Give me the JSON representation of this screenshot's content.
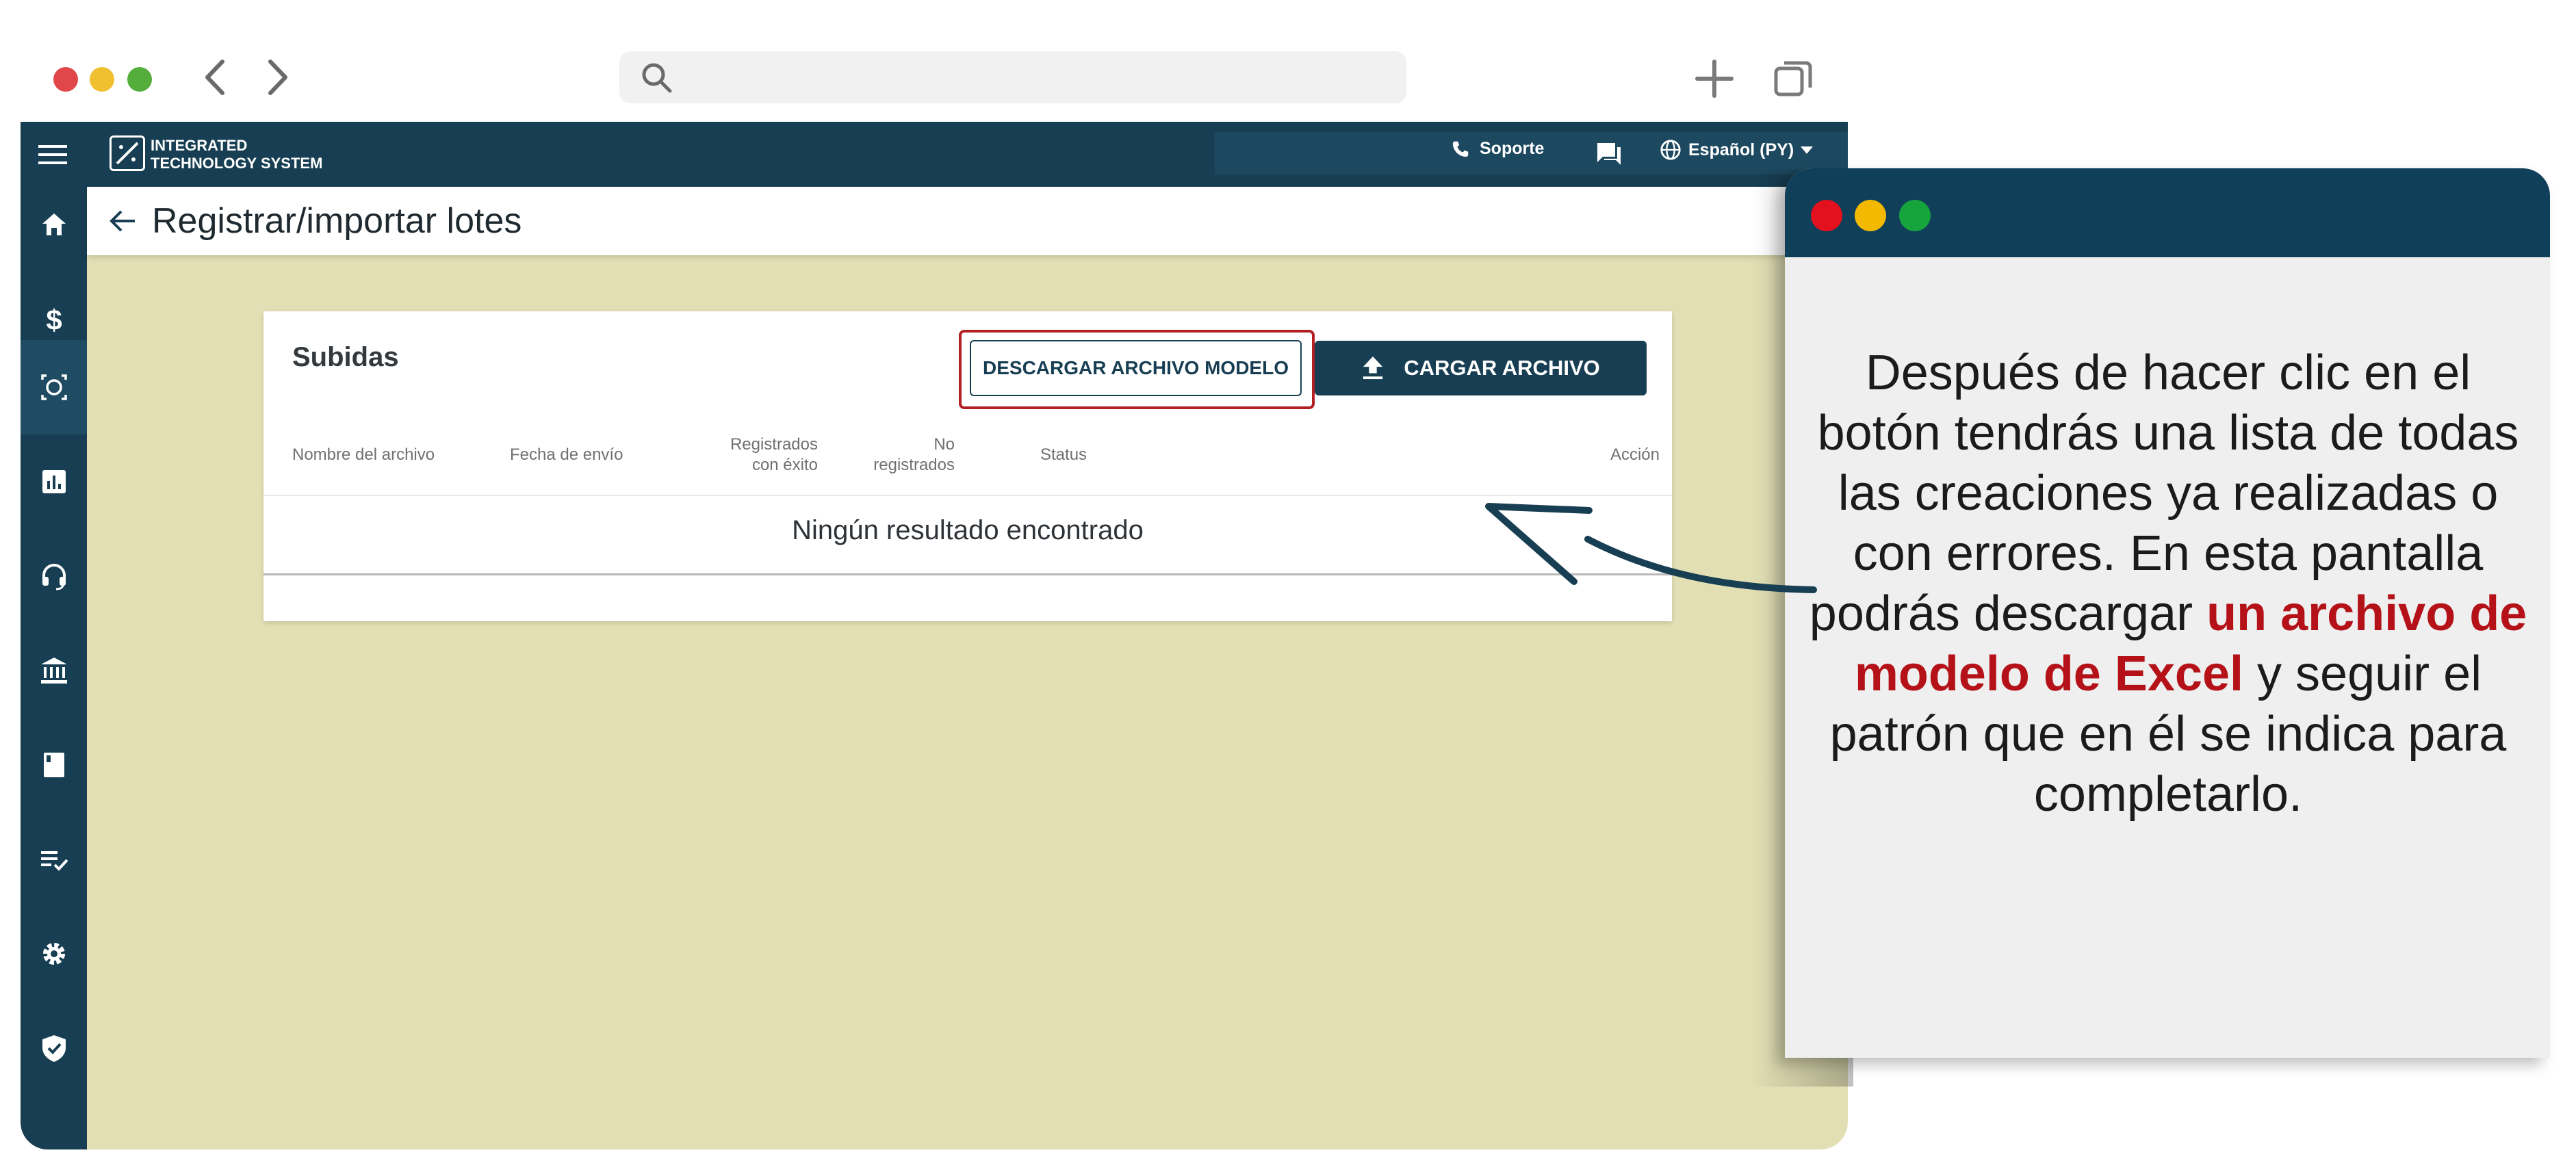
{
  "app": {
    "brand_line1": "INTEGRATED",
    "brand_line2": "TECHNOLOGY SYSTEM",
    "support_label": "Soporte",
    "language_label": "Español (PY)"
  },
  "page": {
    "title": "Registrar/importar lotes"
  },
  "uploads": {
    "title": "Subidas",
    "download_button": "DESCARGAR ARCHIVO MODELO",
    "upload_button": "CARGAR ARCHIVO",
    "columns": {
      "file_name": "Nombre del archivo",
      "send_date": "Fecha de envío",
      "registered_1": "Registrados",
      "registered_2": "con éxito",
      "not_registered_1": "No",
      "not_registered_2": "registrados",
      "status": "Status",
      "action": "Acción"
    },
    "empty_message": "Ningún resultado encontrado"
  },
  "sidebar_icons": [
    "home-icon",
    "dollar-icon",
    "scan-icon",
    "chart-icon",
    "headset-icon",
    "bank-icon",
    "book-icon",
    "checklist-icon",
    "gear-icon",
    "shield-icon"
  ],
  "callout": {
    "text_part1": "Después de hacer clic en el botón tendrás una lista de todas las creaciones ya realizadas o con errores. En esta pantalla podrás descargar ",
    "text_highlight": "un archivo de modelo de Excel",
    "text_part2": " y seguir el patrón que en él se indica para completarlo."
  },
  "colors": {
    "primary": "#173e52",
    "background": "#e2dfb4",
    "highlight_red": "#b41218"
  }
}
